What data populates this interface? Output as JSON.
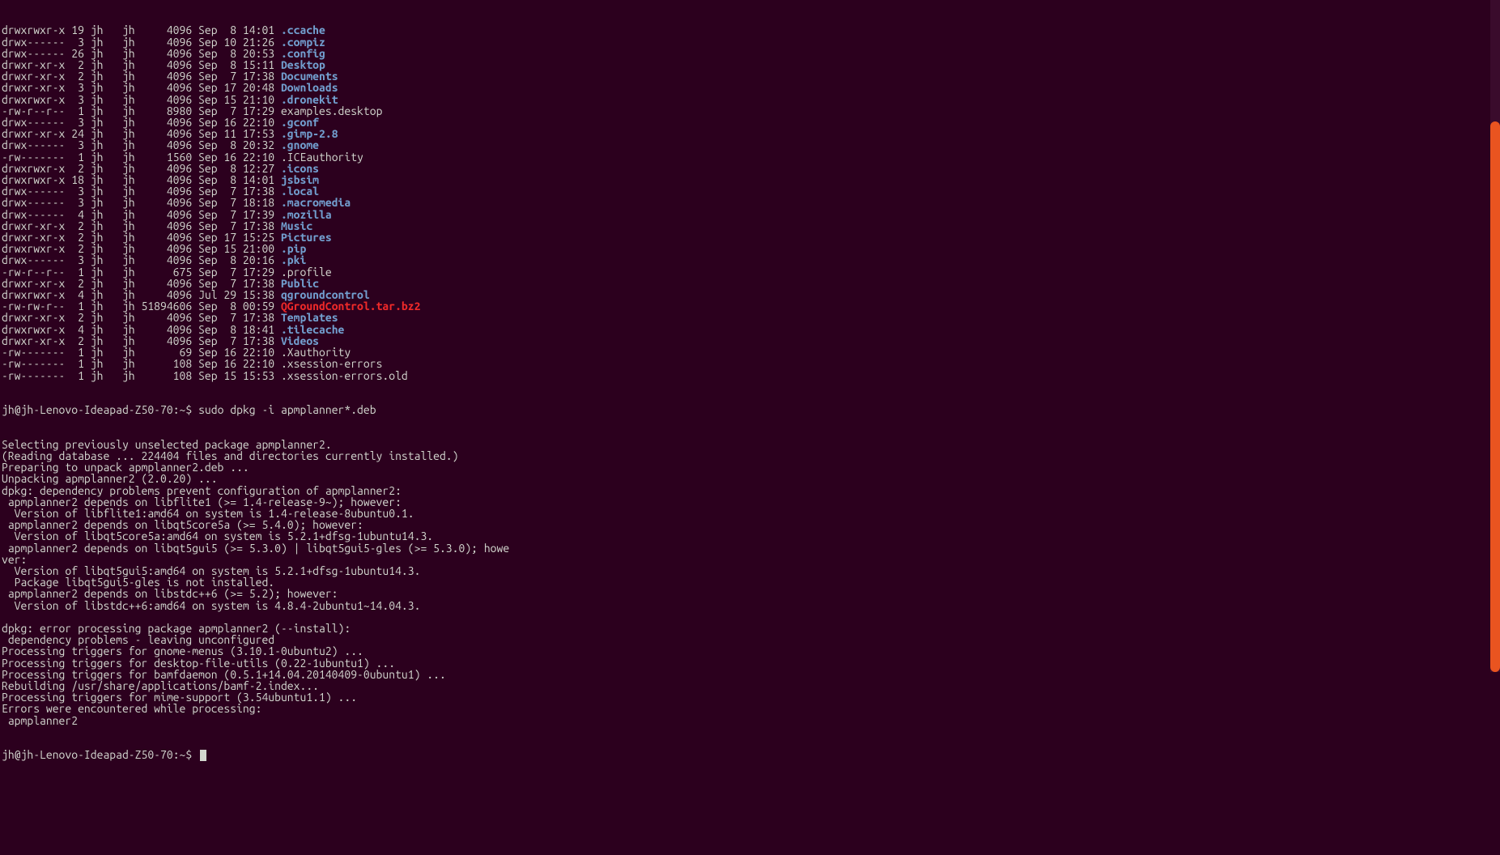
{
  "prompt": {
    "user_host": "jh@jh-Lenovo-Ideapad-Z50-70",
    "path": "~",
    "sep": "$",
    "command": "sudo dpkg -i apmplanner*.deb"
  },
  "ls": [
    {
      "perm": "drwxrwxr-x",
      "links": "19",
      "owner": "jh",
      "group": "jh",
      "size": "4096",
      "date": "Sep  8 14:01",
      "name": ".ccache",
      "cls": "dir"
    },
    {
      "perm": "drwx------",
      "links": " 3",
      "owner": "jh",
      "group": "jh",
      "size": "4096",
      "date": "Sep 10 21:26",
      "name": ".compiz",
      "cls": "dir"
    },
    {
      "perm": "drwx------",
      "links": "26",
      "owner": "jh",
      "group": "jh",
      "size": "4096",
      "date": "Sep  8 20:53",
      "name": ".config",
      "cls": "dir"
    },
    {
      "perm": "drwxr-xr-x",
      "links": " 2",
      "owner": "jh",
      "group": "jh",
      "size": "4096",
      "date": "Sep  8 15:11",
      "name": "Desktop",
      "cls": "dir"
    },
    {
      "perm": "drwxr-xr-x",
      "links": " 2",
      "owner": "jh",
      "group": "jh",
      "size": "4096",
      "date": "Sep  7 17:38",
      "name": "Documents",
      "cls": "dir"
    },
    {
      "perm": "drwxr-xr-x",
      "links": " 3",
      "owner": "jh",
      "group": "jh",
      "size": "4096",
      "date": "Sep 17 20:48",
      "name": "Downloads",
      "cls": "dir"
    },
    {
      "perm": "drwxrwxr-x",
      "links": " 3",
      "owner": "jh",
      "group": "jh",
      "size": "4096",
      "date": "Sep 15 21:10",
      "name": ".dronekit",
      "cls": "dir"
    },
    {
      "perm": "-rw-r--r--",
      "links": " 1",
      "owner": "jh",
      "group": "jh",
      "size": "8980",
      "date": "Sep  7 17:29",
      "name": "examples.desktop",
      "cls": "plain"
    },
    {
      "perm": "drwx------",
      "links": " 3",
      "owner": "jh",
      "group": "jh",
      "size": "4096",
      "date": "Sep 16 22:10",
      "name": ".gconf",
      "cls": "dir"
    },
    {
      "perm": "drwxr-xr-x",
      "links": "24",
      "owner": "jh",
      "group": "jh",
      "size": "4096",
      "date": "Sep 11 17:53",
      "name": ".gimp-2.8",
      "cls": "dir"
    },
    {
      "perm": "drwx------",
      "links": " 3",
      "owner": "jh",
      "group": "jh",
      "size": "4096",
      "date": "Sep  8 20:32",
      "name": ".gnome",
      "cls": "dir"
    },
    {
      "perm": "-rw-------",
      "links": " 1",
      "owner": "jh",
      "group": "jh",
      "size": "1560",
      "date": "Sep 16 22:10",
      "name": ".ICEauthority",
      "cls": "plain"
    },
    {
      "perm": "drwxrwxr-x",
      "links": " 2",
      "owner": "jh",
      "group": "jh",
      "size": "4096",
      "date": "Sep  8 12:27",
      "name": ".icons",
      "cls": "dir"
    },
    {
      "perm": "drwxrwxr-x",
      "links": "18",
      "owner": "jh",
      "group": "jh",
      "size": "4096",
      "date": "Sep  8 14:01",
      "name": "jsbsim",
      "cls": "dir"
    },
    {
      "perm": "drwx------",
      "links": " 3",
      "owner": "jh",
      "group": "jh",
      "size": "4096",
      "date": "Sep  7 17:38",
      "name": ".local",
      "cls": "dir"
    },
    {
      "perm": "drwx------",
      "links": " 3",
      "owner": "jh",
      "group": "jh",
      "size": "4096",
      "date": "Sep  7 18:18",
      "name": ".macromedia",
      "cls": "dir"
    },
    {
      "perm": "drwx------",
      "links": " 4",
      "owner": "jh",
      "group": "jh",
      "size": "4096",
      "date": "Sep  7 17:39",
      "name": ".mozilla",
      "cls": "dir"
    },
    {
      "perm": "drwxr-xr-x",
      "links": " 2",
      "owner": "jh",
      "group": "jh",
      "size": "4096",
      "date": "Sep  7 17:38",
      "name": "Music",
      "cls": "dir"
    },
    {
      "perm": "drwxr-xr-x",
      "links": " 2",
      "owner": "jh",
      "group": "jh",
      "size": "4096",
      "date": "Sep 17 15:25",
      "name": "Pictures",
      "cls": "dir"
    },
    {
      "perm": "drwxrwxr-x",
      "links": " 2",
      "owner": "jh",
      "group": "jh",
      "size": "4096",
      "date": "Sep 15 21:00",
      "name": ".pip",
      "cls": "dir"
    },
    {
      "perm": "drwx------",
      "links": " 3",
      "owner": "jh",
      "group": "jh",
      "size": "4096",
      "date": "Sep  8 20:16",
      "name": ".pki",
      "cls": "dir"
    },
    {
      "perm": "-rw-r--r--",
      "links": " 1",
      "owner": "jh",
      "group": "jh",
      "size": "675",
      "date": "Sep  7 17:29",
      "name": ".profile",
      "cls": "plain"
    },
    {
      "perm": "drwxr-xr-x",
      "links": " 2",
      "owner": "jh",
      "group": "jh",
      "size": "4096",
      "date": "Sep  7 17:38",
      "name": "Public",
      "cls": "dir"
    },
    {
      "perm": "drwxrwxr-x",
      "links": " 4",
      "owner": "jh",
      "group": "jh",
      "size": "4096",
      "date": "Jul 29 15:38",
      "name": "qgroundcontrol",
      "cls": "dir"
    },
    {
      "perm": "-rw-rw-r--",
      "links": " 1",
      "owner": "jh",
      "group": "jh",
      "size": "51894606",
      "date": "Sep  8 00:59",
      "name": "QGroundControl.tar.bz2",
      "cls": "arch"
    },
    {
      "perm": "drwxr-xr-x",
      "links": " 2",
      "owner": "jh",
      "group": "jh",
      "size": "4096",
      "date": "Sep  7 17:38",
      "name": "Templates",
      "cls": "dir"
    },
    {
      "perm": "drwxrwxr-x",
      "links": " 4",
      "owner": "jh",
      "group": "jh",
      "size": "4096",
      "date": "Sep  8 18:41",
      "name": ".tilecache",
      "cls": "dir"
    },
    {
      "perm": "drwxr-xr-x",
      "links": " 2",
      "owner": "jh",
      "group": "jh",
      "size": "4096",
      "date": "Sep  7 17:38",
      "name": "Videos",
      "cls": "dir"
    },
    {
      "perm": "-rw-------",
      "links": " 1",
      "owner": "jh",
      "group": "jh",
      "size": "69",
      "date": "Sep 16 22:10",
      "name": ".Xauthority",
      "cls": "plain"
    },
    {
      "perm": "-rw-------",
      "links": " 1",
      "owner": "jh",
      "group": "jh",
      "size": "108",
      "date": "Sep 16 22:10",
      "name": ".xsession-errors",
      "cls": "plain"
    },
    {
      "perm": "-rw-------",
      "links": " 1",
      "owner": "jh",
      "group": "jh",
      "size": "108",
      "date": "Sep 15 15:53",
      "name": ".xsession-errors.old",
      "cls": "plain"
    }
  ],
  "dpkg_output": [
    "Selecting previously unselected package apmplanner2.",
    "(Reading database ... 224404 files and directories currently installed.)",
    "Preparing to unpack apmplanner2.deb ...",
    "Unpacking apmplanner2 (2.0.20) ...",
    "dpkg: dependency problems prevent configuration of apmplanner2:",
    " apmplanner2 depends on libflite1 (>= 1.4-release-9~); however:",
    "  Version of libflite1:amd64 on system is 1.4-release-8ubuntu0.1.",
    " apmplanner2 depends on libqt5core5a (>= 5.4.0); however:",
    "  Version of libqt5core5a:amd64 on system is 5.2.1+dfsg-1ubuntu14.3.",
    " apmplanner2 depends on libqt5gui5 (>= 5.3.0) | libqt5gui5-gles (>= 5.3.0); howe",
    "ver:",
    "  Version of libqt5gui5:amd64 on system is 5.2.1+dfsg-1ubuntu14.3.",
    "  Package libqt5gui5-gles is not installed.",
    " apmplanner2 depends on libstdc++6 (>= 5.2); however:",
    "  Version of libstdc++6:amd64 on system is 4.8.4-2ubuntu1~14.04.3.",
    "",
    "dpkg: error processing package apmplanner2 (--install):",
    " dependency problems - leaving unconfigured",
    "Processing triggers for gnome-menus (3.10.1-0ubuntu2) ...",
    "Processing triggers for desktop-file-utils (0.22-1ubuntu1) ...",
    "Processing triggers for bamfdaemon (0.5.1+14.04.20140409-0ubuntu1) ...",
    "Rebuilding /usr/share/applications/bamf-2.index...",
    "Processing triggers for mime-support (3.54ubuntu1.1) ...",
    "Errors were encountered while processing:",
    " apmplanner2"
  ]
}
